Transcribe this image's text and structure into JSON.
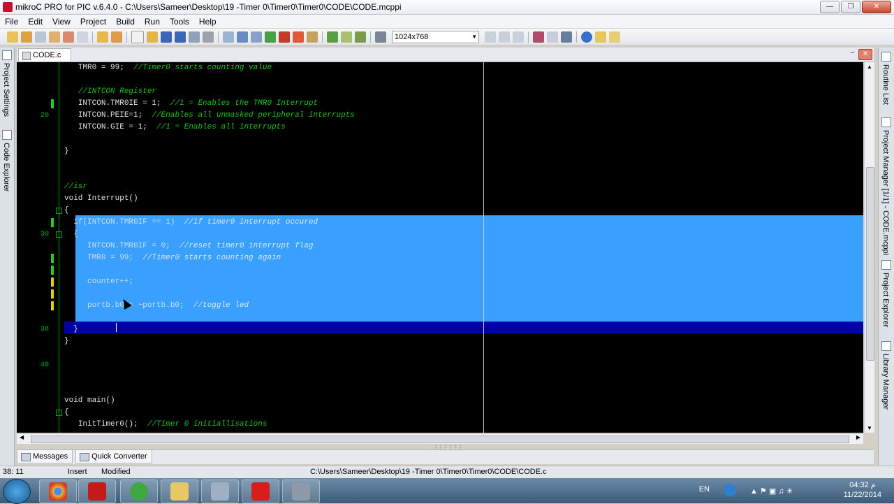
{
  "window": {
    "title": "mikroC PRO for PIC v.6.4.0 - C:\\Users\\Sameer\\Desktop\\19 -Timer 0\\Timer0\\Timer0\\CODE\\CODE.mcppi"
  },
  "menu": [
    "File",
    "Edit",
    "View",
    "Project",
    "Build",
    "Run",
    "Tools",
    "Help"
  ],
  "toolbar": {
    "resolution": "1024x768"
  },
  "doc_tab": {
    "label": "CODE.c"
  },
  "left_panel": {
    "project_settings": "Project Settings",
    "code_explorer": "Code Explorer"
  },
  "right_panel": {
    "routine_list": "Routine List",
    "project_manager": "Project Manager [1/1] - CODE.mcppi",
    "project_explorer": "Project Explorer",
    "library_manager": "Library Manager"
  },
  "code_lines": [
    {
      "ln": "",
      "mark": "",
      "fold": "",
      "text": "TMR0 = 99;",
      "comment": "//Timer0 starts counting value",
      "indent": "   "
    },
    {
      "ln": "",
      "mark": "",
      "fold": "",
      "text": "",
      "comment": "",
      "indent": ""
    },
    {
      "ln": "",
      "mark": "",
      "fold": "",
      "text": "",
      "comment": "//INTCON Register",
      "indent": "   "
    },
    {
      "ln": "",
      "mark": "green",
      "fold": "",
      "text": "INTCON.TMR0IE = 1;",
      "comment": "//1 = Enables the TMR0 Interrupt",
      "indent": "   "
    },
    {
      "ln": "20",
      "mark": "",
      "fold": "",
      "text": "INTCON.PEIE=1;",
      "comment": "//Enables all unmasked peripheral interrupts",
      "indent": "   "
    },
    {
      "ln": "",
      "mark": "",
      "fold": "",
      "text": "INTCON.GIE = 1;",
      "comment": "//1 = Enables all interrupts",
      "indent": "   "
    },
    {
      "ln": "",
      "mark": "",
      "fold": "",
      "text": "",
      "comment": "",
      "indent": ""
    },
    {
      "ln": "",
      "mark": "",
      "fold": "",
      "text": "}",
      "comment": "",
      "indent": ""
    },
    {
      "ln": "",
      "mark": "",
      "fold": "",
      "text": "",
      "comment": "",
      "indent": ""
    },
    {
      "ln": "",
      "mark": "",
      "fold": "",
      "text": "",
      "comment": "",
      "indent": ""
    },
    {
      "ln": "",
      "mark": "",
      "fold": "",
      "text": "",
      "comment": "//isr",
      "indent": ""
    },
    {
      "ln": "",
      "mark": "",
      "fold": "",
      "text": "void Interrupt()",
      "comment": "",
      "indent": ""
    },
    {
      "ln": "",
      "mark": "",
      "fold": "-",
      "text": "{",
      "comment": "",
      "indent": ""
    },
    {
      "ln": "",
      "mark": "green",
      "fold": "",
      "text": "if(INTCON.TMR0IF == 1)",
      "comment": "//if timer0 interrupt occured",
      "indent": "  ",
      "sel": true
    },
    {
      "ln": "30",
      "mark": "",
      "fold": "-",
      "text": "{",
      "comment": "",
      "indent": "  ",
      "sel": true
    },
    {
      "ln": "",
      "mark": "",
      "fold": "",
      "text": "INTCON.TMR0IF = 0;",
      "comment": "//reset timer0 interrupt flag",
      "indent": "     ",
      "sel": true
    },
    {
      "ln": "",
      "mark": "green",
      "fold": "",
      "text": "TMR0 = 99;",
      "comment": "//Timer0 starts counting again",
      "indent": "     ",
      "sel": true
    },
    {
      "ln": "",
      "mark": "green",
      "fold": "",
      "text": "",
      "comment": "",
      "indent": "",
      "sel": true
    },
    {
      "ln": "",
      "mark": "yellow",
      "fold": "",
      "text": "counter++;",
      "comment": "",
      "indent": "     ",
      "sel": true
    },
    {
      "ln": "",
      "mark": "yellow",
      "fold": "",
      "text": "",
      "comment": "",
      "indent": "",
      "sel": true
    },
    {
      "ln": "",
      "mark": "yellow",
      "fold": "",
      "text": "portb.b0 = ~portb.b0;",
      "comment": "//toggle led",
      "indent": "     ",
      "sel": true
    },
    {
      "ln": "",
      "mark": "",
      "fold": "",
      "text": "",
      "comment": "",
      "indent": "",
      "sel": true
    },
    {
      "ln": "38",
      "mark": "",
      "fold": "",
      "text": "}",
      "comment": "",
      "indent": "  ",
      "sel": true
    },
    {
      "ln": "",
      "mark": "",
      "fold": "",
      "text": "}",
      "comment": "",
      "indent": ""
    },
    {
      "ln": "",
      "mark": "",
      "fold": "",
      "text": "",
      "comment": "",
      "indent": ""
    },
    {
      "ln": "40",
      "mark": "",
      "fold": "",
      "text": "",
      "comment": "",
      "indent": ""
    },
    {
      "ln": "",
      "mark": "",
      "fold": "",
      "text": "",
      "comment": "",
      "indent": ""
    },
    {
      "ln": "",
      "mark": "",
      "fold": "",
      "text": "",
      "comment": "",
      "indent": ""
    },
    {
      "ln": "",
      "mark": "",
      "fold": "",
      "text": "void main()",
      "comment": "",
      "indent": ""
    },
    {
      "ln": "",
      "mark": "",
      "fold": "-",
      "text": "{",
      "comment": "",
      "indent": ""
    },
    {
      "ln": "",
      "mark": "",
      "fold": "",
      "text": "InitTimer0();",
      "comment": "//Timer 0 initiallisations",
      "indent": "   "
    }
  ],
  "bottom_tabs": [
    "Messages",
    "Quick Converter"
  ],
  "status": {
    "position": "38: 11",
    "mode": "Insert",
    "state": "Modified",
    "path": "C:\\Users\\Sameer\\Desktop\\19 -Timer 0\\Timer0\\Timer0\\CODE\\CODE.c"
  },
  "taskbar": {
    "language": "EN",
    "time": "04:32 م",
    "date": "11/22/2014"
  },
  "colors": {
    "selection": "#39a0ff",
    "selection_last": "#0000a8",
    "comment": "#18c018",
    "editor_bg": "#000000"
  }
}
